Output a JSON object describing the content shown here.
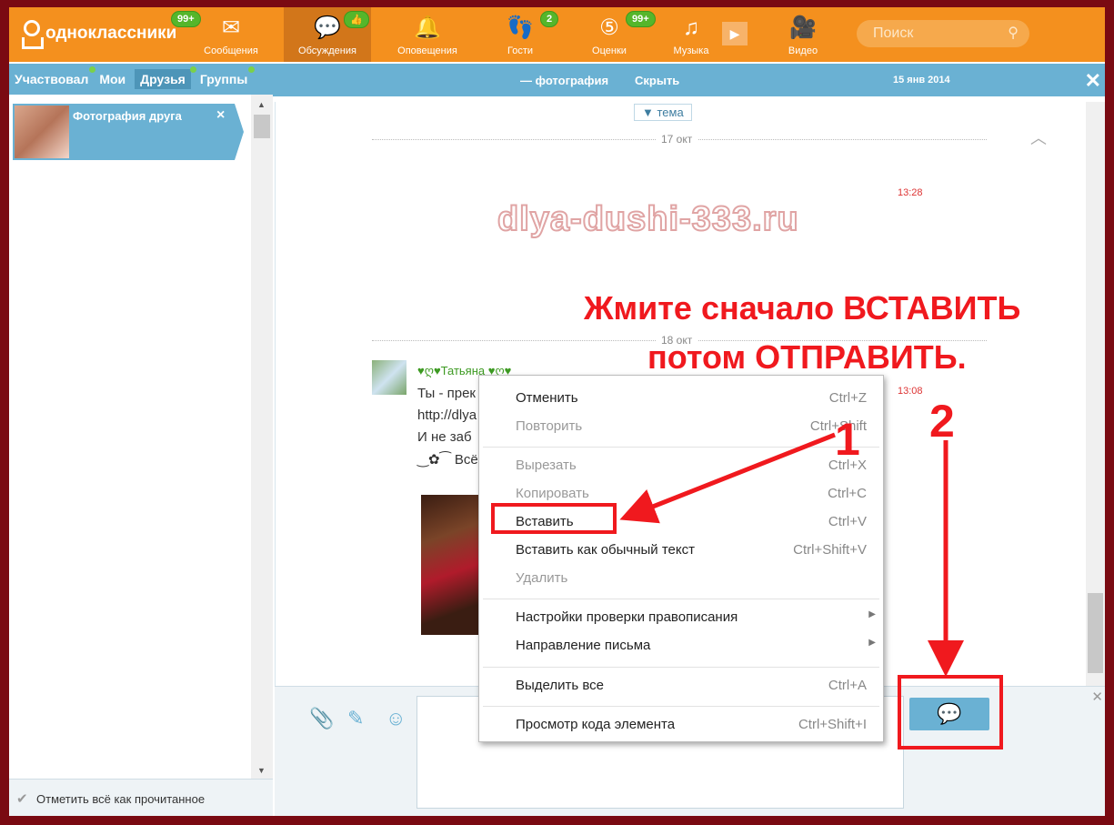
{
  "brand": {
    "name": "одноклассники"
  },
  "topnav": [
    {
      "label": "Сообщения",
      "icon": "envelope-icon",
      "badge": "99+"
    },
    {
      "label": "Обсуждения",
      "icon": "discussions-icon",
      "badge": "👍",
      "active": true
    },
    {
      "label": "Оповещения",
      "icon": "bell-icon",
      "badge": ""
    },
    {
      "label": "Гости",
      "icon": "footprints-icon",
      "badge": "2"
    },
    {
      "label": "Оценки",
      "icon": "rating-icon",
      "badge": "99+"
    },
    {
      "label": "Музыка",
      "icon": "music-icon",
      "badge": ""
    },
    {
      "label": "Видео",
      "icon": "video-icon",
      "badge": ""
    }
  ],
  "search": {
    "placeholder": "Поиск"
  },
  "left_tabs": [
    "Участвовал",
    "Мои",
    "Друзья",
    "Группы"
  ],
  "conversation": {
    "title": "Фотография друга",
    "close": "×"
  },
  "left_footer": {
    "label": "Отметить всё как прочитанное"
  },
  "chat_header": {
    "title": "— фотография",
    "hide": "Скрыть",
    "date": "15 янв 2014",
    "close": "✕"
  },
  "chat": {
    "tema": "▼ тема",
    "date1": "17 окт",
    "date2": "18 окт",
    "time1": "13:28",
    "time2": "13:08",
    "watermark": "dlya-dushi-333.ru",
    "author": "♥ღ♥Татьяна ♥ღ♥",
    "lines": [
      "Ты - прек",
      "http://dlya",
      "И не заб",
      "‿✿⁀ Всё"
    ]
  },
  "context_menu": [
    {
      "label": "Отменить",
      "shortcut": "Ctrl+Z",
      "disabled": false
    },
    {
      "label": "Повторить",
      "shortcut": "Ctrl+Shift",
      "disabled": true
    },
    {
      "label": "Вырезать",
      "shortcut": "Ctrl+X",
      "disabled": true
    },
    {
      "label": "Копировать",
      "shortcut": "Ctrl+C",
      "disabled": true
    },
    {
      "label": "Вставить",
      "shortcut": "Ctrl+V",
      "disabled": false
    },
    {
      "label": "Вставить как обычный текст",
      "shortcut": "Ctrl+Shift+V",
      "disabled": false
    },
    {
      "label": "Удалить",
      "shortcut": "",
      "disabled": true
    },
    {
      "label": "Настройки проверки правописания",
      "shortcut": "",
      "disabled": false,
      "submenu": true
    },
    {
      "label": "Направление письма",
      "shortcut": "",
      "disabled": false,
      "submenu": true
    },
    {
      "label": "Выделить все",
      "shortcut": "Ctrl+A",
      "disabled": false
    },
    {
      "label": "Просмотр кода элемента",
      "shortcut": "Ctrl+Shift+I",
      "disabled": false
    }
  ],
  "annotations": {
    "line1": "Жмите сначало ВСТАВИТЬ",
    "line2": "потом ОТПРАВИТЬ.",
    "step1": "1",
    "step2": "2"
  },
  "colors": {
    "brand": "#f4901e",
    "accent": "#6ab1d3",
    "annotation": "#f0191e",
    "badge": "#55b62b"
  }
}
